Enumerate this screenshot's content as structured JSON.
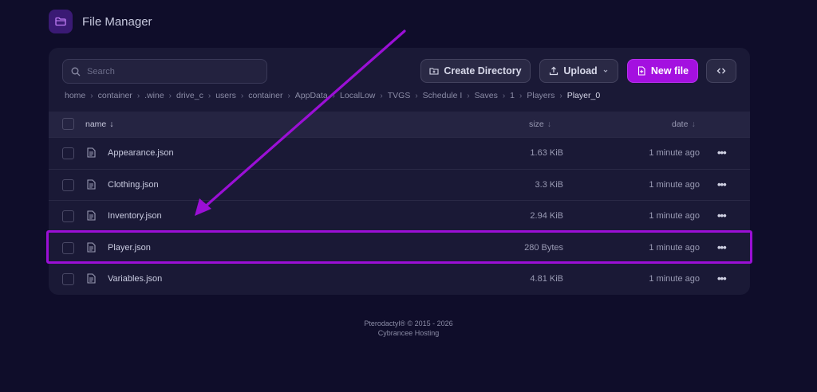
{
  "header": {
    "title": "File Manager",
    "icon": "folder-icon"
  },
  "toolbar": {
    "search_placeholder": "Search",
    "create_directory": "Create Directory",
    "upload": "Upload",
    "new_file": "New file"
  },
  "breadcrumbs": [
    "home",
    "container",
    ".wine",
    "drive_c",
    "users",
    "container",
    "AppData",
    "LocalLow",
    "TVGS",
    "Schedule I",
    "Saves",
    "1",
    "Players",
    "Player_0"
  ],
  "table": {
    "col_name": "name",
    "col_size": "size",
    "col_date": "date",
    "rows": [
      {
        "name": "Appearance.json",
        "size": "1.63 KiB",
        "date": "1 minute ago"
      },
      {
        "name": "Clothing.json",
        "size": "3.3 KiB",
        "date": "1 minute ago"
      },
      {
        "name": "Inventory.json",
        "size": "2.94 KiB",
        "date": "1 minute ago"
      },
      {
        "name": "Player.json",
        "size": "280 Bytes",
        "date": "1 minute ago"
      },
      {
        "name": "Variables.json",
        "size": "4.81 KiB",
        "date": "1 minute ago"
      }
    ]
  },
  "footer": {
    "line1": "Pterodactyl® © 2015 - 2026",
    "line2": "Cybrancee Hosting"
  },
  "colors": {
    "accent": "#a410e0",
    "annotation": "#9b0fd6",
    "background": "#0f0d2a",
    "panel": "#1a1936"
  }
}
